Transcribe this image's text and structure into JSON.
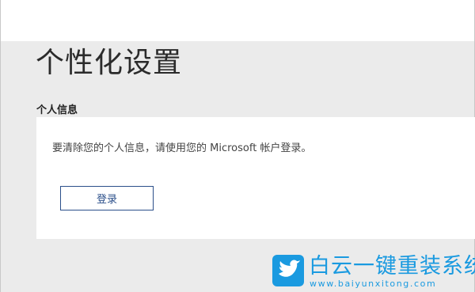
{
  "page": {
    "title": "个性化设置"
  },
  "personal_info": {
    "heading": "个人信息",
    "description": "要清除您的个人信息，请使用您的 Microsoft 帐户登录。",
    "signin_label": "登录"
  },
  "watermark": {
    "brand": "白云一键重装系统",
    "url": "www.baiyunxitong.com",
    "color": "#1a9ae0",
    "icon": "bird-icon"
  },
  "colors": {
    "background": "#ebebeb",
    "card": "#ffffff",
    "button_border": "#2b4f8a"
  }
}
